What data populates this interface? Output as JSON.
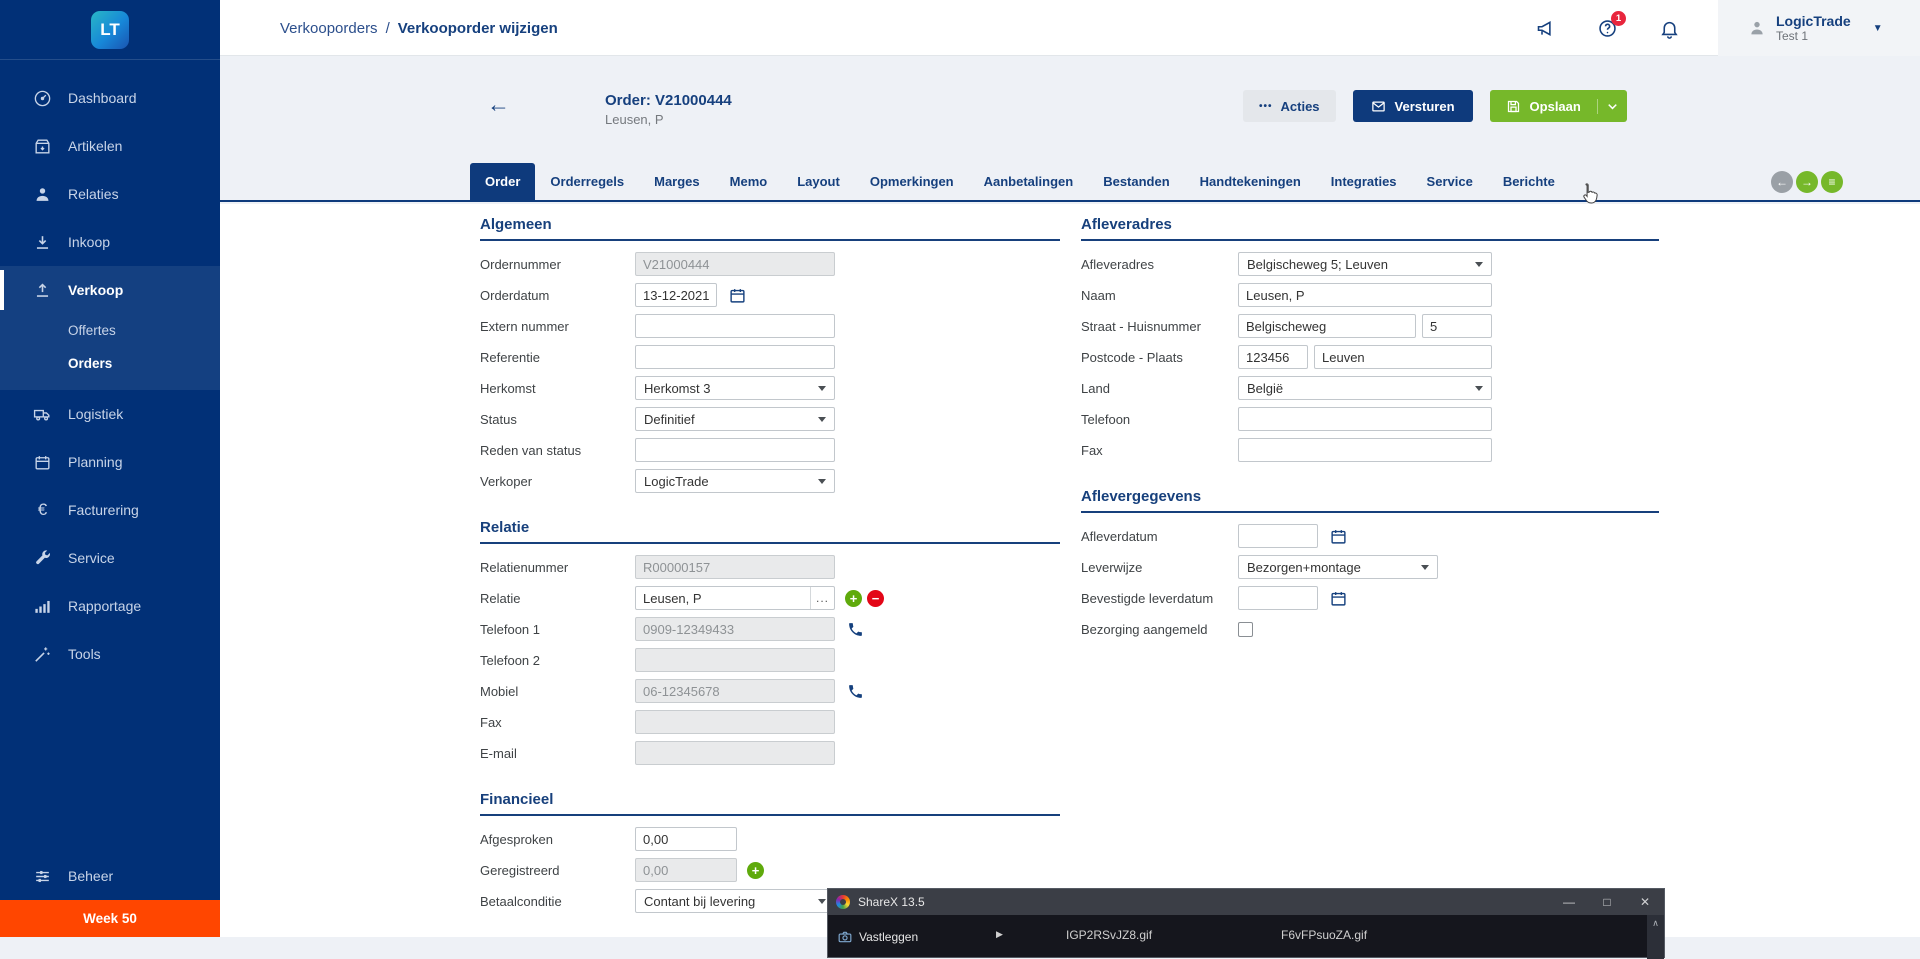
{
  "app": {
    "logo_text": "LT"
  },
  "sidebar": {
    "items": [
      {
        "label": "Dashboard"
      },
      {
        "label": "Artikelen"
      },
      {
        "label": "Relaties"
      },
      {
        "label": "Inkoop"
      },
      {
        "label": "Verkoop"
      },
      {
        "label": "Logistiek"
      },
      {
        "label": "Planning"
      },
      {
        "label": "Facturering"
      },
      {
        "label": "Service"
      },
      {
        "label": "Rapportage"
      },
      {
        "label": "Tools"
      },
      {
        "label": "Beheer"
      }
    ],
    "verkoop_children": [
      {
        "label": "Offertes"
      },
      {
        "label": "Orders"
      }
    ],
    "week_label": "Week 50"
  },
  "header": {
    "breadcrumb_parent": "Verkooporders",
    "breadcrumb_sep": "/",
    "breadcrumb_current": "Verkooporder wijzigen",
    "help_badge": "1",
    "user_name": "LogicTrade",
    "user_sub": "Test 1"
  },
  "page": {
    "title": "Order: V21000444",
    "subtitle": "Leusen, P",
    "back_glyph": "←",
    "actions": {
      "acties_dots": "•••",
      "acties": "Acties",
      "versturen": "Versturen",
      "opslaan": "Opslaan"
    }
  },
  "tabs": [
    "Order",
    "Orderregels",
    "Marges",
    "Memo",
    "Layout",
    "Opmerkingen",
    "Aanbetalingen",
    "Bestanden",
    "Handtekeningen",
    "Integraties",
    "Service",
    "Berichte"
  ],
  "tab_nav": {
    "prev": "←",
    "next": "→",
    "menu": "≡"
  },
  "form": {
    "sections": {
      "algemeen": {
        "title": "Algemeen",
        "fields": [
          {
            "label": "Ordernummer",
            "value": "V21000444"
          },
          {
            "label": "Orderdatum",
            "value": "13-12-2021"
          },
          {
            "label": "Extern nummer",
            "value": ""
          },
          {
            "label": "Referentie",
            "value": ""
          },
          {
            "label": "Herkomst",
            "value": "Herkomst 3"
          },
          {
            "label": "Status",
            "value": "Definitief"
          },
          {
            "label": "Reden van status",
            "value": ""
          },
          {
            "label": "Verkoper",
            "value": "LogicTrade"
          }
        ]
      },
      "relatie": {
        "title": "Relatie",
        "ellipsis": "...",
        "plus": "+",
        "minus": "−",
        "fields": [
          {
            "label": "Relatienummer",
            "value": "R00000157"
          },
          {
            "label": "Relatie",
            "value": "Leusen, P"
          },
          {
            "label": "Telefoon 1",
            "value": "0909-12349433"
          },
          {
            "label": "Telefoon 2",
            "value": ""
          },
          {
            "label": "Mobiel",
            "value": "06-12345678"
          },
          {
            "label": "Fax",
            "value": ""
          },
          {
            "label": "E-mail",
            "value": ""
          }
        ]
      },
      "financieel": {
        "title": "Financieel",
        "plus": "+",
        "fields": [
          {
            "label": "Afgesproken",
            "value": "0,00"
          },
          {
            "label": "Geregistreerd",
            "value": "0,00"
          },
          {
            "label": "Betaalconditie",
            "value": "Contant bij levering"
          }
        ]
      },
      "afleveradres": {
        "title": "Afleveradres",
        "fields": [
          {
            "label": "Afleveradres",
            "value": "Belgischeweg 5; Leuven"
          },
          {
            "label": "Naam",
            "value": "Leusen, P"
          },
          {
            "label": "Straat - Huisnummer",
            "value": "Belgischeweg",
            "value2": "5"
          },
          {
            "label": "Postcode - Plaats",
            "value": "123456",
            "value2": "Leuven"
          },
          {
            "label": "Land",
            "value": "België"
          },
          {
            "label": "Telefoon",
            "value": ""
          },
          {
            "label": "Fax",
            "value": ""
          }
        ]
      },
      "aflevergegevens": {
        "title": "Aflevergegevens",
        "fields": [
          {
            "label": "Afleverdatum",
            "value": ""
          },
          {
            "label": "Leverwijze",
            "value": "Bezorgen+montage"
          },
          {
            "label": "Bevestigde leverdatum",
            "value": ""
          },
          {
            "label": "Bezorging aangemeld"
          }
        ]
      }
    }
  },
  "sharex": {
    "title": "ShareX 13.5",
    "minimize": "—",
    "maximize": "□",
    "close": "✕",
    "menu_item": "Vastleggen",
    "submenu_arrow": "▶",
    "files": [
      "IGP2RSvJZ8.gif",
      "F6vFPsuoZA.gif"
    ],
    "scroll_up": "∧"
  },
  "colors": {
    "sidebar_navy": "#013077",
    "accent_navy": "#0e3a7c",
    "green": "#76b82a",
    "red": "#e30617",
    "week_orange": "#ff4600",
    "badge_red": "#e8263d"
  }
}
